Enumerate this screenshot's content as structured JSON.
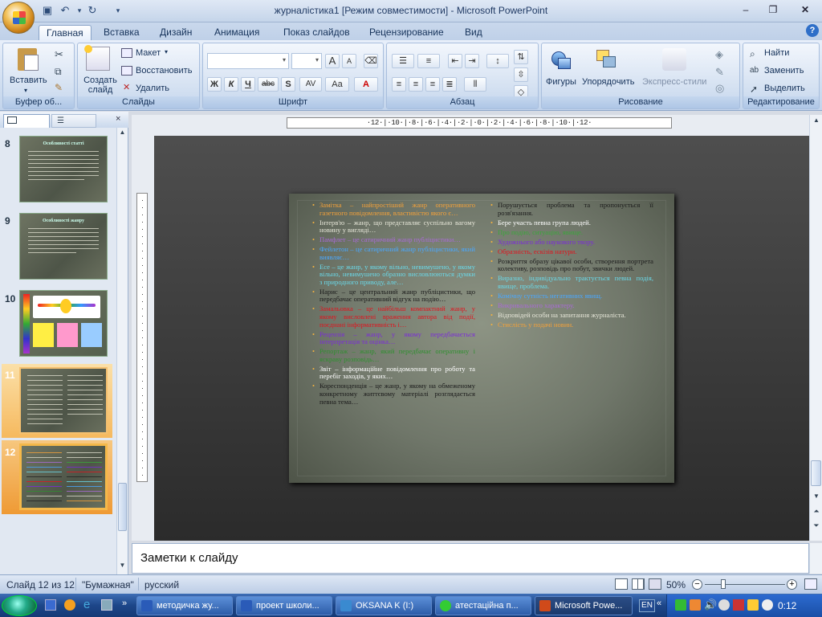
{
  "window": {
    "title": "журналістика1 [Режим совместимости] - Microsoft PowerPoint"
  },
  "tabs": [
    "Главная",
    "Вставка",
    "Дизайн",
    "Анимация",
    "Показ слайдов",
    "Рецензирование",
    "Вид"
  ],
  "ribbon": {
    "clipboard": {
      "paste": "Вставить",
      "label": "Буфер об..."
    },
    "slides": {
      "new_slide": "Создать слайд",
      "layout": "Макет",
      "reset": "Восстановить",
      "delete": "Удалить",
      "label": "Слайды"
    },
    "font": {
      "label": "Шрифт",
      "bold": "Ж",
      "italic": "К",
      "underline": "Ч",
      "strike": "abc",
      "shadow": "S",
      "spacing": "AV",
      "case": "Aa",
      "color": "A",
      "grow": "A",
      "shrink": "A"
    },
    "paragraph": {
      "label": "Абзац"
    },
    "drawing": {
      "shapes": "Фигуры",
      "arrange": "Упорядочить",
      "quick_styles": "Экспресс-стили",
      "label": "Рисование"
    },
    "editing": {
      "find": "Найти",
      "replace": "Заменить",
      "select": "Выделить",
      "label": "Редактирование"
    }
  },
  "thumbnails": [
    {
      "num": "8",
      "title": "Особливості статті"
    },
    {
      "num": "9",
      "title": "Особливості жанру"
    },
    {
      "num": "10",
      "title": ""
    },
    {
      "num": "11",
      "title": ""
    },
    {
      "num": "12",
      "title": ""
    }
  ],
  "ruler": {
    "horizontal": "·12·|·10·|·8·|·6·|·4·|·2·|·0·|·2·|·4·|·6·|·8·|·10·|·12·"
  },
  "slide": {
    "left_items": [
      {
        "text": "Замітка – найпростіший жанр оперативного газетного повідомлення, властивістю якого є…",
        "color": "#f3a13a"
      },
      {
        "text": "Інтерв'ю – жанр, що представляє суспільно вагому новину у вигляді…",
        "color": "#e6e6d8"
      },
      {
        "text": "Памфлет – це сатиричний жанр публіцистики…",
        "color": "#a96bd6"
      },
      {
        "text": "Фейлетон – це сатиричний жанр публіцистики, який виявляє…",
        "color": "#4aa8ff"
      },
      {
        "text": "Есе – це жанр, у якому вільно, невимушено, у якому вільно, невимушено образно висловлюються думки з природного приводу, але…",
        "color": "#6ad8e8"
      },
      {
        "text": "Нарис – це центральний жанр публіцистики, що передбачає оперативний відгук на подію…",
        "color": "#1b1b1b"
      },
      {
        "text": "Замальовка – це найбільш компактний жанр, у якому висловлені враження автора від події, поєднані інформативність і…",
        "color": "#e0141e"
      },
      {
        "text": "Рецензія – жанр, у якому передбачається інтерпретація та оцінка…",
        "color": "#7b2bd9"
      },
      {
        "text": "Репортаж – жанр, який передбачає оперативну і яскраву розповідь…",
        "color": "#2f8f2f"
      },
      {
        "text": "Звіт – інформаційне повідомлення про роботу та перебіг заходів, у яких…",
        "color": "#ffffff"
      },
      {
        "text": "Кореспонденція – це жанр, у якому на обмеженому конкретному життєвому матеріалі розглядається певна тема…",
        "color": "#1b1b1b"
      }
    ],
    "right_items": [
      {
        "text": "Порушується проблема та пропонується її розв'язання.",
        "color": "#1b1b1b"
      },
      {
        "text": "Бере участь певна група людей.",
        "color": "#ffffff"
      },
      {
        "text": "Про подію, ситуацію, явище.",
        "color": "#3aa63a"
      },
      {
        "text": "Художнього або наукового твору.",
        "color": "#7b2bd9"
      },
      {
        "text": "Образність, ескізів натури.",
        "color": "#e0141e"
      },
      {
        "text": "Розкриття образу цікавої особи, створення портрета колективу, розповідь про побут, звички людей.",
        "color": "#1b1b1b"
      },
      {
        "text": "Виразно, індивідуально трактується певна подія, явище, проблема.",
        "color": "#6ad8e8"
      },
      {
        "text": "Комічну сутність негативних явищ.",
        "color": "#4aa8ff"
      },
      {
        "text": "Викривального характеру.",
        "color": "#a96bd6"
      },
      {
        "text": "Відповідей особи на запитання журналіста.",
        "color": "#e6e6d8"
      },
      {
        "text": "Стислість у подачі новин.",
        "color": "#f3a13a"
      }
    ]
  },
  "notes": {
    "placeholder": "Заметки к слайду"
  },
  "status": {
    "slide_count": "Слайд 12 из 12",
    "theme": "\"Бумажная\"",
    "language": "русский",
    "zoom": "50%"
  },
  "taskbar": {
    "items": [
      {
        "label": "методичка жу...",
        "color": "#2a5bb8"
      },
      {
        "label": "проект школи...",
        "color": "#2a5bb8"
      },
      {
        "label": "OKSANA K (I:)",
        "color": "#3a8ad0"
      },
      {
        "label": "атестаційна п...",
        "color": "#e0b020"
      },
      {
        "label": "Microsoft Powe...",
        "color": "#d04a1a"
      }
    ],
    "lang": "EN",
    "clock": "0:12"
  }
}
